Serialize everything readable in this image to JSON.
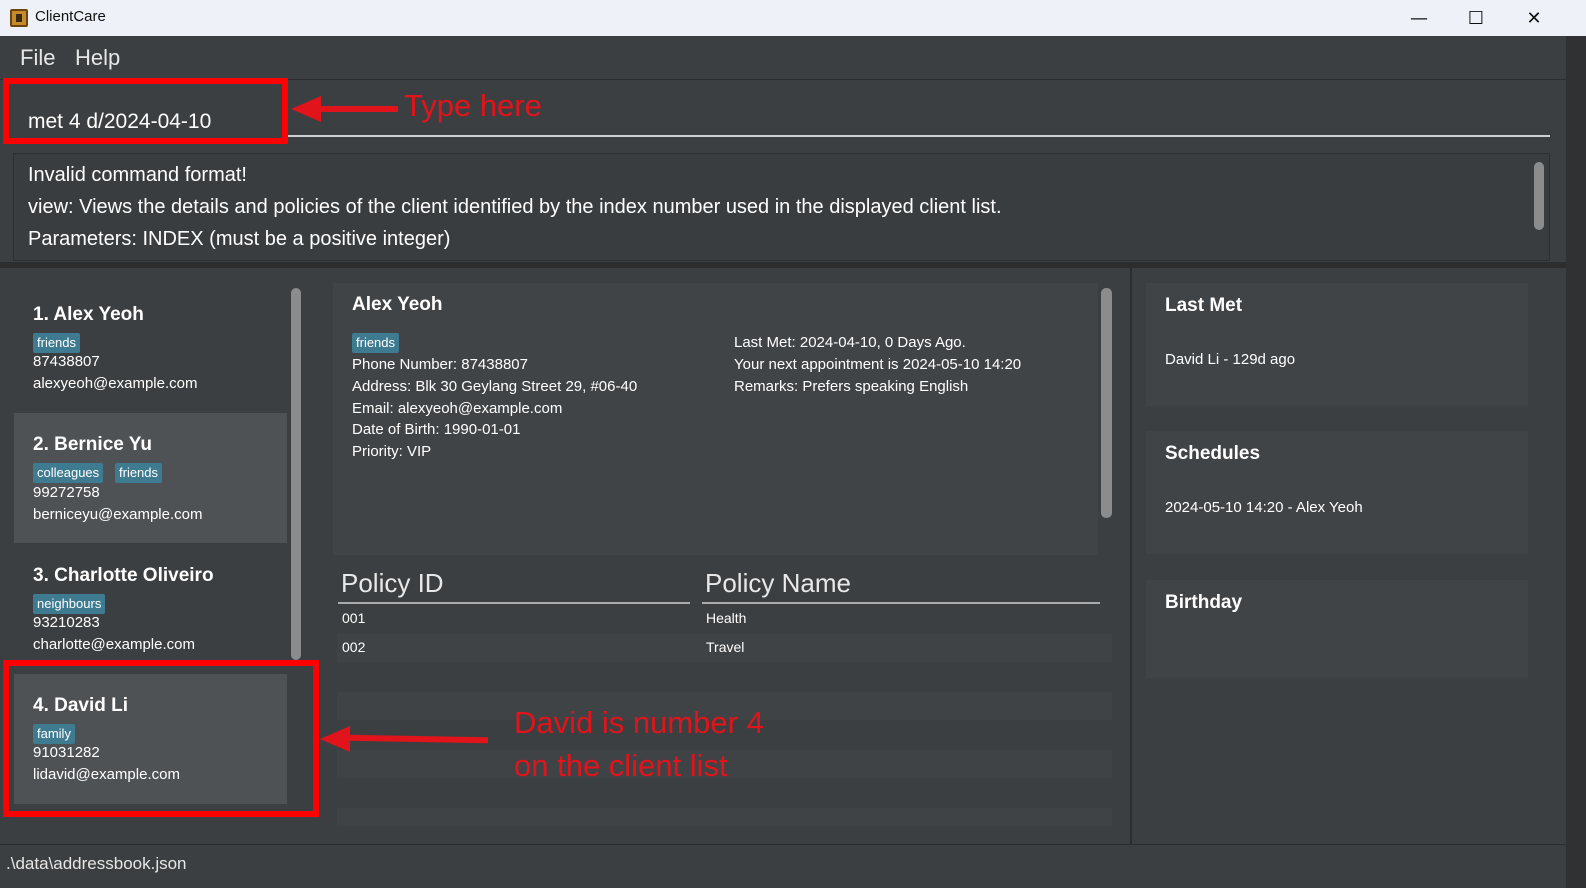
{
  "window": {
    "title": "ClientCare",
    "minimize": "—",
    "maximize": "☐",
    "close": "✕"
  },
  "menu": {
    "file": "File",
    "help": "Help"
  },
  "command": {
    "value": "met 4 d/2024-04-10"
  },
  "result": {
    "line1": "Invalid command format!",
    "line2": "view: Views the details and policies of the client identified by the index number used in the displayed client list.",
    "line3": "Parameters: INDEX (must be a positive integer)"
  },
  "clients": [
    {
      "name": "1.  Alex Yeoh",
      "tags": [
        "friends"
      ],
      "phone": "87438807",
      "email": "alexyeoh@example.com"
    },
    {
      "name": "2.  Bernice Yu",
      "tags": [
        "colleagues",
        "friends"
      ],
      "phone": "99272758",
      "email": "berniceyu@example.com"
    },
    {
      "name": "3.  Charlotte Oliveiro",
      "tags": [
        "neighbours"
      ],
      "phone": "93210283",
      "email": "charlotte@example.com"
    },
    {
      "name": "4.  David Li",
      "tags": [
        "family"
      ],
      "phone": "91031282",
      "email": "lidavid@example.com"
    }
  ],
  "detail": {
    "name": "Alex Yeoh",
    "tag": "friends",
    "phone": "Phone Number: 87438807",
    "address": "Address: Blk 30 Geylang Street 29, #06-40",
    "email": "Email: alexyeoh@example.com",
    "dob": "Date of Birth: 1990-01-01",
    "priority": "Priority: VIP",
    "last_met": "Last Met: 2024-04-10, 0 Days Ago.",
    "next_appt": "Your next appointment is 2024-05-10 14:20",
    "remarks": "Remarks: Prefers speaking English"
  },
  "policies": {
    "headers": [
      "Policy ID",
      "Policy Name"
    ],
    "rows": [
      {
        "id": "001",
        "name": "Health"
      },
      {
        "id": "002",
        "name": "Travel"
      }
    ]
  },
  "side": {
    "last_met_title": "Last Met",
    "last_met_item": "David Li - 129d ago",
    "schedules_title": "Schedules",
    "schedules_item": "2024-05-10 14:20 - Alex Yeoh",
    "birthday_title": "Birthday"
  },
  "status": {
    "path": ".\\data\\addressbook.json"
  },
  "annotations": {
    "type_here": "Type here",
    "david_line1": "David is number 4",
    "david_line2": "on the client list"
  },
  "colors": {
    "accent_tag": "#3e7b91",
    "annotation_red": "#e0141a",
    "background": "#3c3f41"
  }
}
